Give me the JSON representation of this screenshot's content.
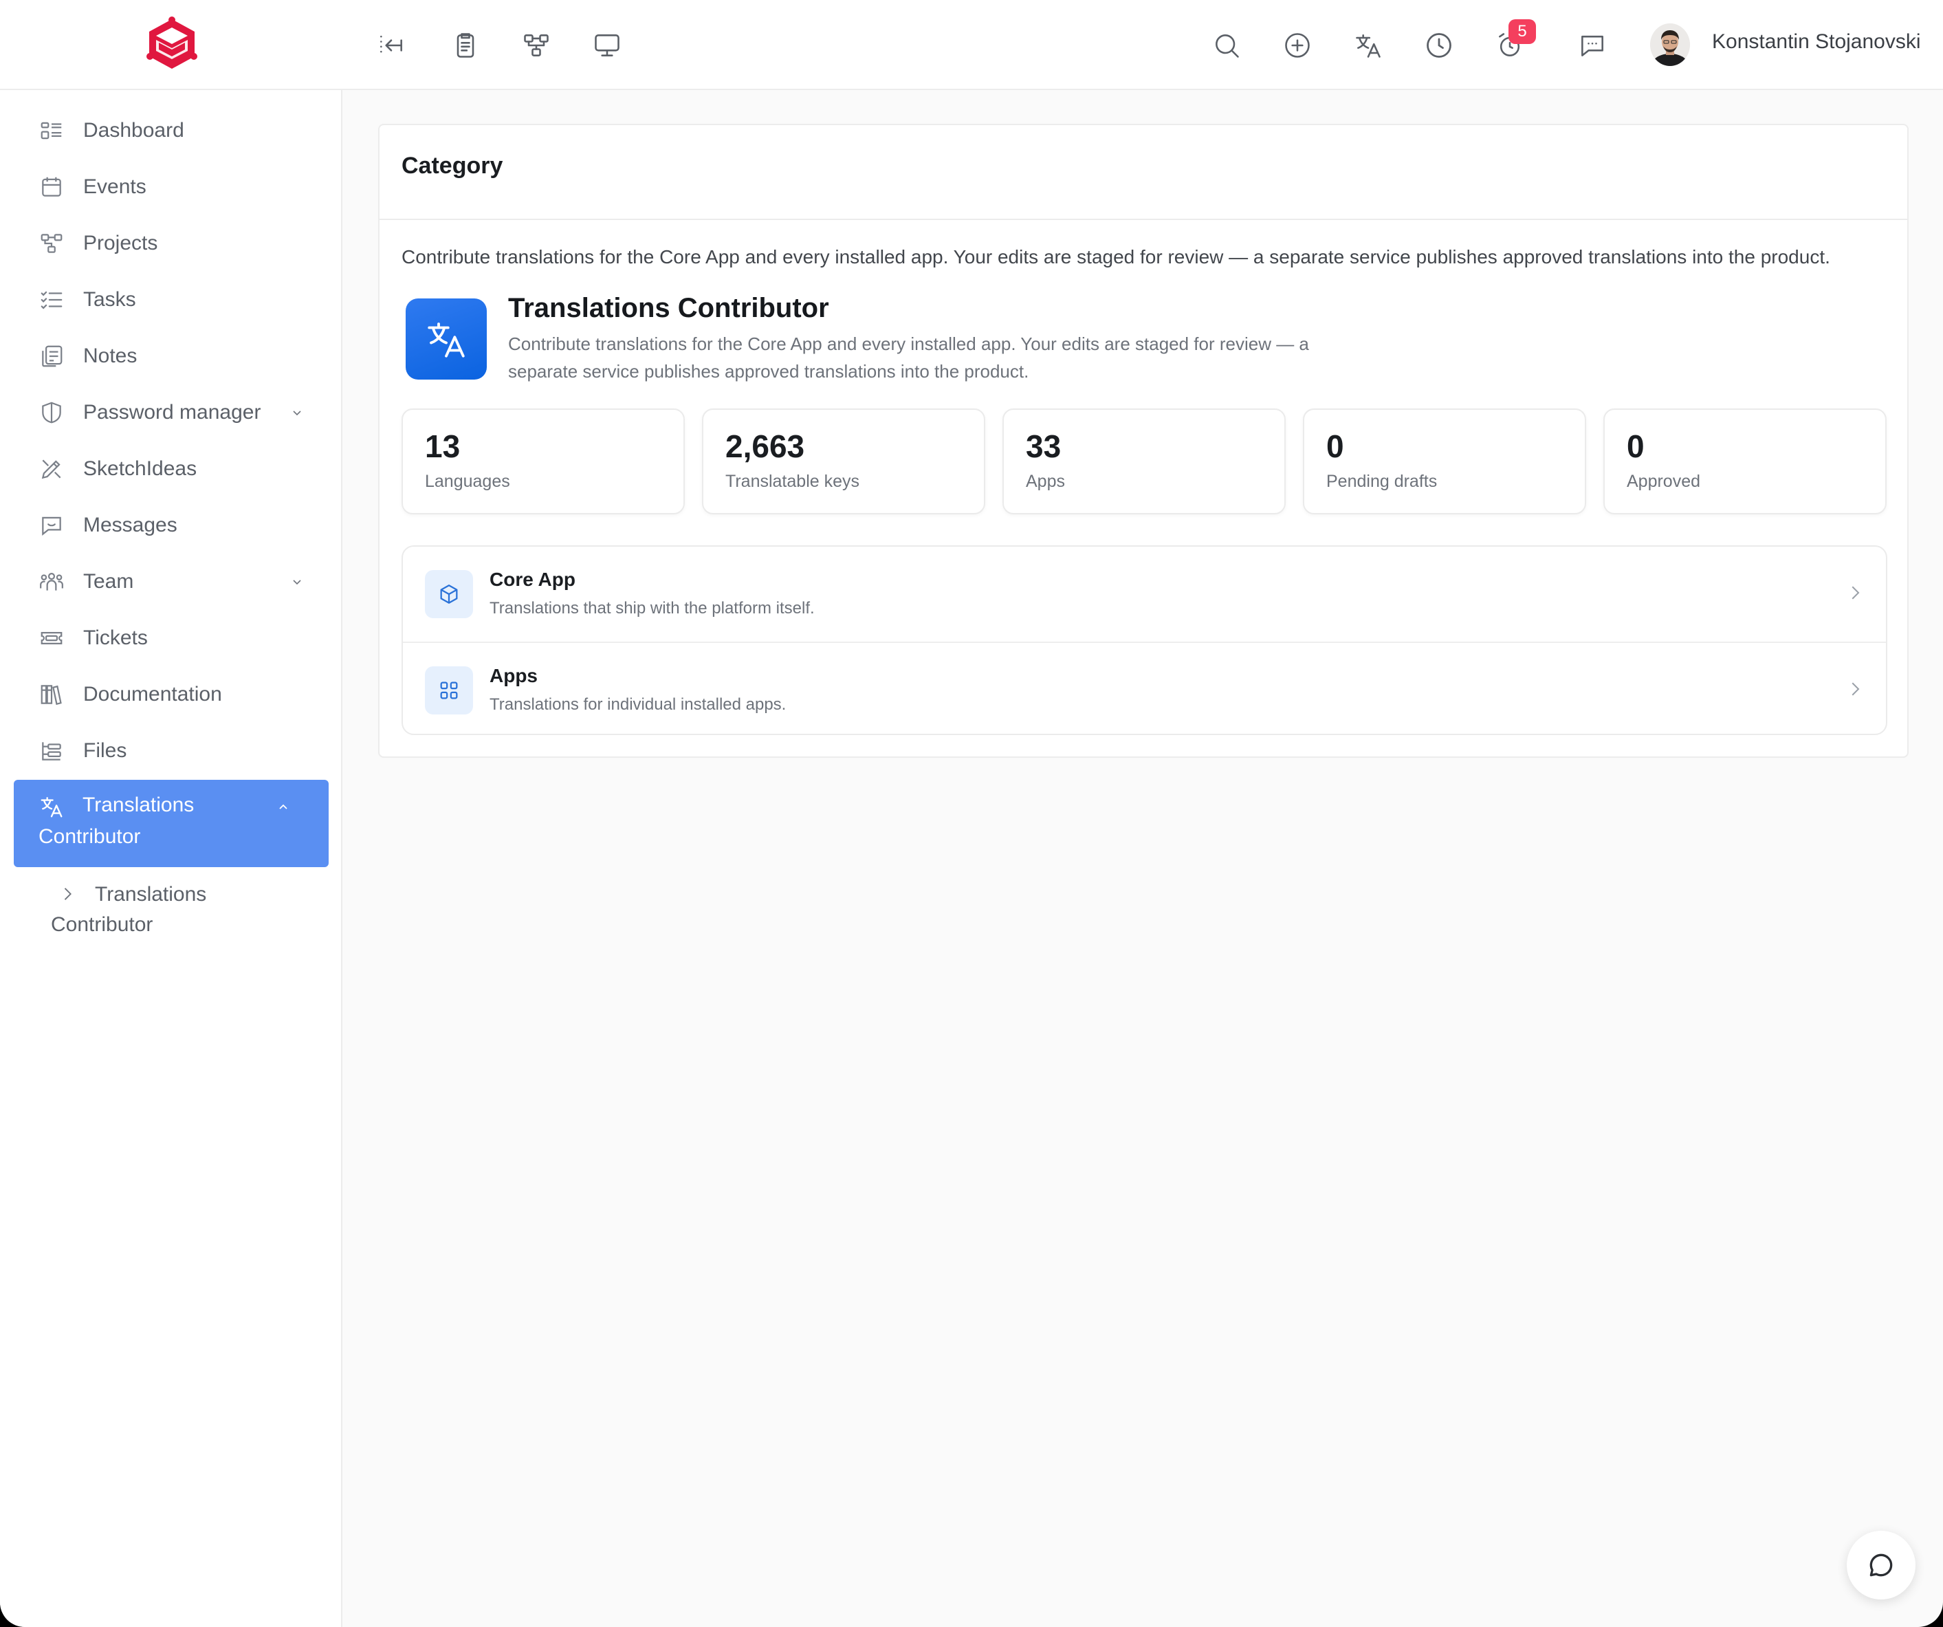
{
  "topbar": {
    "icons": [
      "collapse-sidebar-icon",
      "clipboard-icon",
      "workflow-icon",
      "monitor-icon"
    ],
    "right_icons": [
      "search-icon",
      "add-circle-icon",
      "translate-icon",
      "clock-icon",
      "alarm-icon",
      "chat-icon"
    ],
    "notification_count": "5",
    "user_name": "Konstantin Stojanovski",
    "brand_color": "#e0173f"
  },
  "sidebar": {
    "items": [
      {
        "label": "Dashboard",
        "icon": "dashboard-icon"
      },
      {
        "label": "Events",
        "icon": "calendar-icon"
      },
      {
        "label": "Projects",
        "icon": "projects-icon"
      },
      {
        "label": "Tasks",
        "icon": "tasks-icon"
      },
      {
        "label": "Notes",
        "icon": "notes-icon"
      },
      {
        "label": "Password manager",
        "icon": "shield-icon",
        "has_submenu": true
      },
      {
        "label": "SketchIdeas",
        "icon": "sketch-icon"
      },
      {
        "label": "Messages",
        "icon": "messages-icon"
      },
      {
        "label": "Team",
        "icon": "team-icon",
        "has_submenu": true
      },
      {
        "label": "Tickets",
        "icon": "ticket-icon"
      },
      {
        "label": "Documentation",
        "icon": "books-icon"
      },
      {
        "label": "Files",
        "icon": "files-icon"
      }
    ],
    "active": {
      "line1": "Translations",
      "line2": "Contributor",
      "icon": "translate-icon"
    },
    "sub_item": {
      "line1": "Translations",
      "line2": "Contributor"
    },
    "active_color": "#5a8ff2"
  },
  "main": {
    "title": "Category",
    "intro": "Contribute translations for the Core App and every installed app. Your edits are staged for review — a separate service publishes approved translations into the product.",
    "hero": {
      "title": "Translations Contributor",
      "description": "Contribute translations for the Core App and every installed app. Your edits are staged for review — a separate service publishes approved translations into the product."
    },
    "stats": [
      {
        "value": "13",
        "label": "Languages"
      },
      {
        "value": "2,663",
        "label": "Translatable keys"
      },
      {
        "value": "33",
        "label": "Apps"
      },
      {
        "value": "0",
        "label": "Pending drafts"
      },
      {
        "value": "0",
        "label": "Approved"
      }
    ],
    "rows": [
      {
        "title": "Core App",
        "description": "Translations that ship with the platform itself.",
        "icon": "cube-icon"
      },
      {
        "title": "Apps",
        "description": "Translations for individual installed apps.",
        "icon": "grid-icon"
      }
    ]
  }
}
